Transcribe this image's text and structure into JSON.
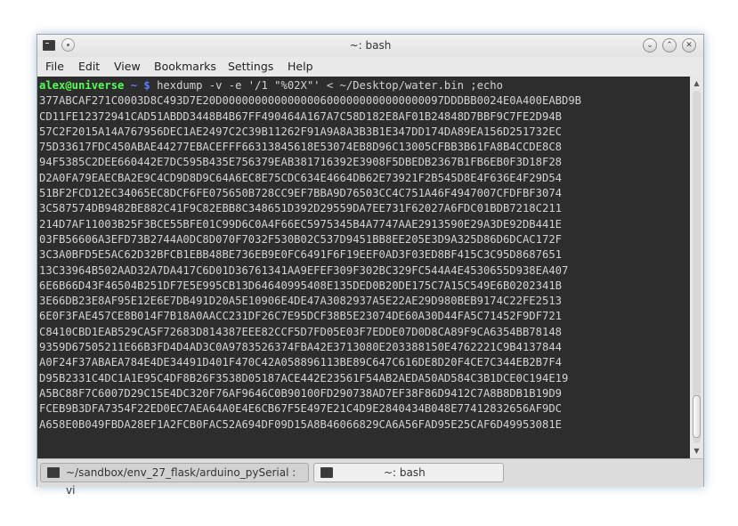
{
  "window": {
    "title": "~: bash",
    "buttons": {
      "minimize": "⌄",
      "maximize": "⌃",
      "close": "✕"
    }
  },
  "menubar": {
    "items": [
      "File",
      "Edit",
      "View",
      "Bookmarks",
      "Settings",
      "Help"
    ]
  },
  "terminal": {
    "prompt_user": "alex@universe",
    "prompt_path": " ~ $ ",
    "command": "hexdump -v -e '/1 \"%02X\"' < ~/Desktop/water.bin ;echo",
    "lines": [
      "377ABCAF271C0003D8C493D7E20D0000000000000006000000000000000097DDDBB0024E0A400EABD9B",
      "CD11FE12372941CAD51ABDD3448B4B67FF490464A167A7C58D182E8AF01B24848D7BBF9C7FE2D94B",
      "57C2F2015A14A767956DEC1AE2497C2C39B11262F91A9A8A3B3B1E347DD174DA89EA156D251732EC",
      "75D33617FDC450ABAE44277EBACEFFF66313845618E53074EB8D96C13005CFBB3B61FA8B4CCDE8C8",
      "94F5385C2DEE660442E7DC595B435E756379EAB381716392E3908F5DBEDB2367B1FB6EB0F3D18F28",
      "D2A0FA79EAECBA2E9C4CD9D8D9C64A6EC8E75CDC634E4664DB62E73921F2B545D8E4F636E4F29D54",
      "51BF2FCD12EC34065EC8DCF6FE075650B728CC9EF7BBA9D76503CC4C751A46F4947007CFDFBF3074",
      "3C587574DB9482BE882C41F9C82EBB8C348651D392D29559DA7EE731F62027A6FDC01BDB7218C211",
      "214D7AF11003B25F3BCE55BFE01C99D6C0A4F66EC5975345B4A7747AAE2913590E29A3DE92DB441E",
      "03FB56606A3EFD73B2744A0DC8D070F7032F530B02C537D9451BB8EE205E3D9A325D86D6DCAC172F",
      "3C3A0BFD5E5AC62D32BFCB1EBB48BE736EB9E0FC6491F6F19EEF0AD3F03ED8BF415C3C95D8687651",
      "13C33964B502AAD32A7DA417C6D01D36761341AA9EFEF309F302BC329FC544A4E4530655D938EA407",
      "6E6B66D43F46504B251DF7E5E995CB13D64640995408E135DED0B20DE175C7A15C549E6B0202341B",
      "3E66DB23E8AF95E12E6E7DB491D20A5E10906E4DE47A3082937A5E22AE29D980BEB9174C22FE2513",
      "6E0F3FAE457CE8B014F7B18A0AACC231DF26C7E95DCF38B5E23074DE60A30D44FA5C71452F9DF721",
      "C8410CBD1EAB529CA5F72683D814387EEE82CCF5D7FD05E03F7EDDE07D0D8CA89F9CA6354BB78148",
      "9359D67505211E66B3FD4D4AD3C0A9783526374FBA42E3713080E203388150E4762221C9B4137844",
      "A0F24F37ABAEA784E4DE34491D401F470C42A058896113BE89C647C616DE8D20F4CE7C344EB2B7F4",
      "D95B2331C4DC1A1E95C4DF8B26F3538D05187ACE442E23561F54AB2AEDA50AD584C3B1DCE0C194E19",
      "A5BC88F7C6007D29C15E4DC320F76AF9646C0B90100FD290738AD7EF38F86D9412C7A8B8DB1B19D9",
      "FCEB9B3DFA7354F22ED0EC7AEA64A0E4E6CB67F5E497E21C4D9E2840434B048E77412832656AF9DC",
      "A658E0B049FBDA28EF1A2FCB0FAC52A694DF09D15A8B46066829CA6A56FAD95E25CAF6D49953081E"
    ]
  },
  "tabs": [
    {
      "label": "~/sandbox/env_27_flask/arduino_pySerial : vi",
      "active": false
    },
    {
      "label": "~: bash",
      "active": true
    }
  ]
}
